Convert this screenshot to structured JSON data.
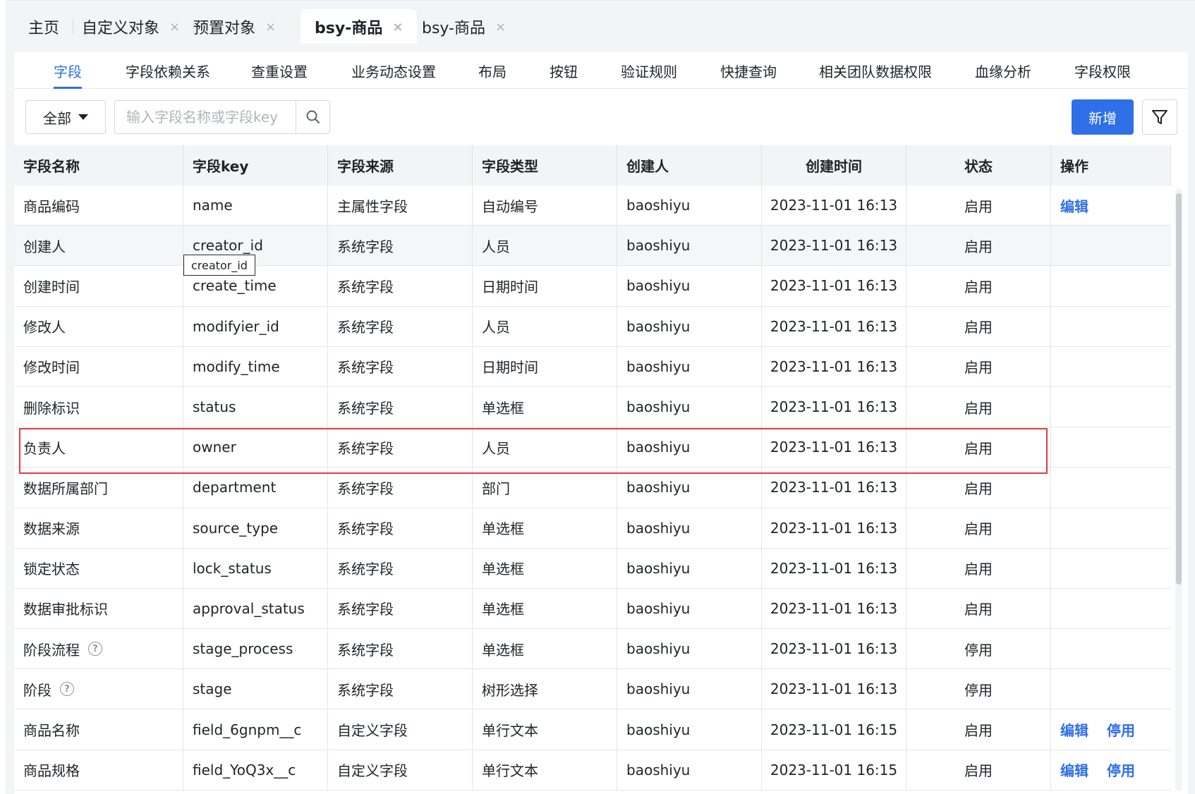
{
  "top_tabs": [
    {
      "label": "主页",
      "closable": false
    },
    {
      "label": "自定义对象",
      "closable": true
    },
    {
      "label": "预置对象",
      "closable": true
    },
    {
      "label": "bsy-商品",
      "closable": true,
      "active": true
    },
    {
      "label": "bsy-商品",
      "closable": true
    }
  ],
  "close_glyph": "×",
  "sub_tabs": [
    "字段",
    "字段依赖关系",
    "查重设置",
    "业务动态设置",
    "布局",
    "按钮",
    "验证规则",
    "快捷查询",
    "相关团队数据权限",
    "血缘分析",
    "字段权限"
  ],
  "toolbar": {
    "select_value": "全部",
    "search_placeholder": "输入字段名称或字段key",
    "add_label": "新增"
  },
  "table": {
    "headers": [
      "字段名称",
      "字段key",
      "字段来源",
      "字段类型",
      "创建人",
      "创建时间",
      "状态",
      "操作"
    ],
    "rows": [
      {
        "name": "商品编码",
        "key": "name",
        "source": "主属性字段",
        "type": "自动编号",
        "creator": "baoshiyu",
        "time": "2023-11-01 16:13",
        "status": "启用",
        "ops": [
          "编辑"
        ]
      },
      {
        "name": "创建人",
        "key": "creator_id",
        "source": "系统字段",
        "type": "人员",
        "creator": "baoshiyu",
        "time": "2023-11-01 16:13",
        "status": "启用",
        "ops": []
      },
      {
        "name": "创建时间",
        "key": "create_time",
        "source": "系统字段",
        "type": "日期时间",
        "creator": "baoshiyu",
        "time": "2023-11-01 16:13",
        "status": "启用",
        "ops": []
      },
      {
        "name": "修改人",
        "key": "modifyier_id",
        "source": "系统字段",
        "type": "人员",
        "creator": "baoshiyu",
        "time": "2023-11-01 16:13",
        "status": "启用",
        "ops": []
      },
      {
        "name": "修改时间",
        "key": "modify_time",
        "source": "系统字段",
        "type": "日期时间",
        "creator": "baoshiyu",
        "time": "2023-11-01 16:13",
        "status": "启用",
        "ops": []
      },
      {
        "name": "删除标识",
        "key": "status",
        "source": "系统字段",
        "type": "单选框",
        "creator": "baoshiyu",
        "time": "2023-11-01 16:13",
        "status": "启用",
        "ops": []
      },
      {
        "name": "负责人",
        "key": "owner",
        "source": "系统字段",
        "type": "人员",
        "creator": "baoshiyu",
        "time": "2023-11-01 16:13",
        "status": "启用",
        "ops": []
      },
      {
        "name": "数据所属部门",
        "key": "department",
        "source": "系统字段",
        "type": "部门",
        "creator": "baoshiyu",
        "time": "2023-11-01 16:13",
        "status": "启用",
        "ops": []
      },
      {
        "name": "数据来源",
        "key": "source_type",
        "source": "系统字段",
        "type": "单选框",
        "creator": "baoshiyu",
        "time": "2023-11-01 16:13",
        "status": "启用",
        "ops": []
      },
      {
        "name": "锁定状态",
        "key": "lock_status",
        "source": "系统字段",
        "type": "单选框",
        "creator": "baoshiyu",
        "time": "2023-11-01 16:13",
        "status": "启用",
        "ops": []
      },
      {
        "name": "数据审批标识",
        "key": "approval_status",
        "source": "系统字段",
        "type": "单选框",
        "creator": "baoshiyu",
        "time": "2023-11-01 16:13",
        "status": "启用",
        "ops": []
      },
      {
        "name": "阶段流程",
        "help": "?",
        "key": "stage_process",
        "source": "系统字段",
        "type": "单选框",
        "creator": "baoshiyu",
        "time": "2023-11-01 16:13",
        "status": "停用",
        "ops": []
      },
      {
        "name": "阶段",
        "help": "?",
        "key": "stage",
        "source": "系统字段",
        "type": "树形选择",
        "creator": "baoshiyu",
        "time": "2023-11-01 16:13",
        "status": "停用",
        "ops": []
      },
      {
        "name": "商品名称",
        "key": "field_6gnpm__c",
        "source": "自定义字段",
        "type": "单行文本",
        "creator": "baoshiyu",
        "time": "2023-11-01 16:15",
        "status": "启用",
        "ops": [
          "编辑",
          "停用"
        ]
      },
      {
        "name": "商品规格",
        "key": "field_YoQ3x__c",
        "source": "自定义字段",
        "type": "单行文本",
        "creator": "baoshiyu",
        "time": "2023-11-01 16:15",
        "status": "启用",
        "ops": [
          "编辑",
          "停用"
        ]
      }
    ]
  },
  "tooltip": {
    "text": "creator_id"
  },
  "colors": {
    "accent": "#2f6fe8",
    "highlight": "#e03c3c"
  }
}
